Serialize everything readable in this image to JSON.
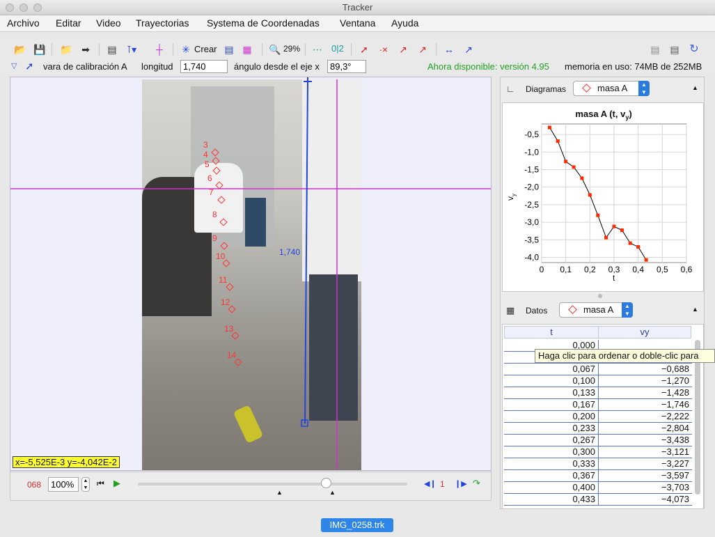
{
  "window": {
    "title": "Tracker"
  },
  "menu": [
    "Archivo",
    "Editar",
    "Video",
    "Trayectorias",
    "Systema de Coordenadas",
    "Ventana",
    "Ayuda"
  ],
  "toolbar": {
    "crear_label": "Crear",
    "zoom_label": "29%",
    "frame_label": "0|2",
    "icons": [
      "open-icon",
      "save-icon",
      "open-folder-icon",
      "import-icon",
      "video-clip-icon",
      "axes-icon",
      "calibration-icon",
      "create-star-icon",
      "ruler-icon",
      "grid-icon",
      "zoom-icon",
      "points-icon",
      "trail-icon",
      "path-icon",
      "marker-icon",
      "velocity-icon",
      "acceleration-icon",
      "footprint-icon",
      "mass-icon",
      "notes-icon",
      "notes2-icon",
      "refresh-icon"
    ]
  },
  "calibration": {
    "tool_label": "vara de calibración A",
    "length_label": "longitud",
    "length_value": "1,740",
    "angle_label": "ángulo desde el eje x",
    "angle_value": "89,3°",
    "update_notice": "Ahora disponible: versión 4.95",
    "memory": "memoria en uso: 74MB de 252MB"
  },
  "video": {
    "stick_label": "1,740",
    "trail_labels": [
      "3",
      "4",
      "5",
      "6",
      "7",
      "8",
      "9",
      "10",
      "11",
      "12",
      "13",
      "14"
    ],
    "coords_readout": "x=-5,525E-3  y=-4,042E-2"
  },
  "player": {
    "frame_counter": "068",
    "zoom_value": "100%",
    "step_value": "1"
  },
  "plot_panel": {
    "label": "Diagramas",
    "track": "masa A",
    "title_main": "masa A (t, v",
    "title_sub": "y",
    "title_close": ")",
    "xlabel": "t",
    "ylabel_main": "v",
    "ylabel_sub": "y"
  },
  "chart_data": {
    "type": "line",
    "x": [
      0.033,
      0.067,
      0.1,
      0.133,
      0.167,
      0.2,
      0.233,
      0.267,
      0.3,
      0.333,
      0.367,
      0.4,
      0.433
    ],
    "series": [
      {
        "values": [
          -0.3,
          -0.688,
          -1.27,
          -1.428,
          -1.746,
          -2.222,
          -2.804,
          -3.438,
          -3.121,
          -3.227,
          -3.597,
          -3.703,
          -4.073
        ]
      }
    ],
    "xlim": [
      0,
      0.6
    ],
    "ylim": [
      -4.15,
      -0.2
    ],
    "xticks": [
      "0",
      "0,1",
      "0,2",
      "0,3",
      "0,4",
      "0,5",
      "0,6"
    ],
    "yticks": [
      "-0,5",
      "-1,0",
      "-1,5",
      "-2,0",
      "-2,5",
      "-3,0",
      "-3,5",
      "-4,0"
    ],
    "ytick_values": [
      -0.5,
      -1.0,
      -1.5,
      -2.0,
      -2.5,
      -3.0,
      -3.5,
      -4.0
    ],
    "xtick_values": [
      0,
      0.1,
      0.2,
      0.3,
      0.4,
      0.5,
      0.6
    ],
    "grid": true,
    "marker_color": "#ff2a00",
    "line_color": "#000000"
  },
  "table_panel": {
    "label": "Datos",
    "track": "masa A",
    "headers": [
      "t",
      "vy"
    ],
    "rows": [
      [
        "0,000",
        ""
      ],
      [
        "",
        ""
      ],
      [
        "0,067",
        "−0,688"
      ],
      [
        "0,100",
        "−1,270"
      ],
      [
        "0,133",
        "−1,428"
      ],
      [
        "0,167",
        "−1,746"
      ],
      [
        "0,200",
        "−2,222"
      ],
      [
        "0,233",
        "−2,804"
      ],
      [
        "0,267",
        "−3,438"
      ],
      [
        "0,300",
        "−3,121"
      ],
      [
        "0,333",
        "−3,227"
      ],
      [
        "0,367",
        "−3,597"
      ],
      [
        "0,400",
        "−3,703"
      ],
      [
        "0,433",
        "−4,073"
      ]
    ],
    "tooltip": "Haga clic para ordenar o doble-clic para"
  },
  "file_tab": "IMG_0258.trk",
  "colors": {
    "trail": "#ff3333",
    "axis_magenta": "#cc33cc",
    "stick_blue": "#2244dd",
    "notice_green": "#22a022",
    "tab_blue": "#2e86e8"
  }
}
